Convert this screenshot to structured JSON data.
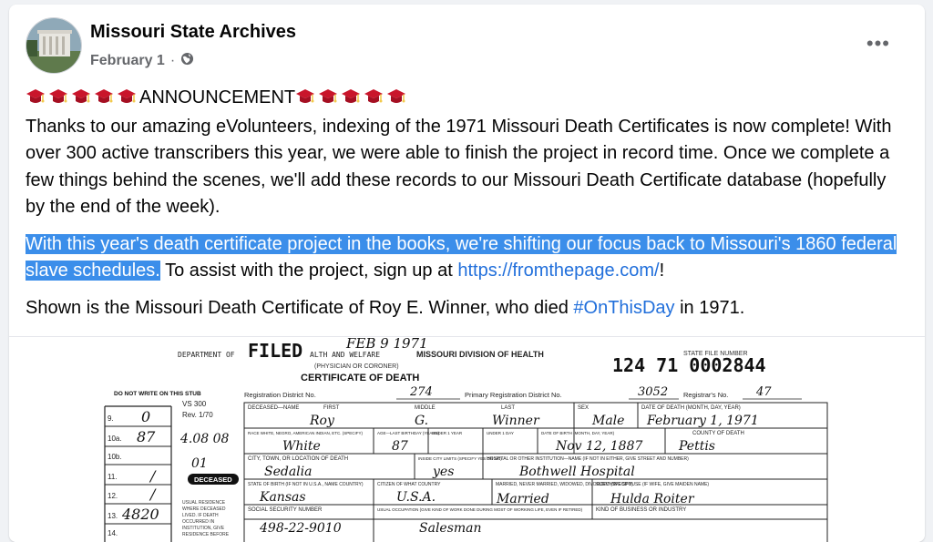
{
  "post": {
    "page_name": "Missouri State Archives",
    "date": "February 1",
    "separator": "·",
    "announcement_caps_count": 5,
    "announcement_word": "ANNOUNCEMENT",
    "paragraph1": "Thanks to our amazing eVolunteers, indexing of the 1971 Missouri Death Certificates is now complete! With over 300 active transcribers this year, we were able to finish the project in record time. Once we complete a few things behind the scenes, we'll add these records to our Missouri Death Certificate database (hopefully by the end of the week).",
    "paragraph2_highlighted": "With this year's death certificate project in the books, we're shifting our focus back to Missouri's 1860 federal slave schedules.",
    "paragraph2_rest": " To assist with the project, sign up at ",
    "paragraph2_link": "https://fromthepage.com/",
    "paragraph2_end": "!",
    "paragraph3_start": "Shown is the Missouri Death Certificate of Roy E. Winner, who died ",
    "paragraph3_hashtag": "#OnThisDay",
    "paragraph3_end": " in 1971."
  },
  "certificate": {
    "header_left": "DEPARTMENT OF",
    "filed_stamp": "FILED",
    "header_mid": "ALTH AND WELFARE",
    "header_right": "MISSOURI DIVISION OF HEALTH",
    "date_stamp": "FEB 9   1971",
    "physician": "(PHYSICIAN OR CORONER)",
    "title": "CERTIFICATE OF DEATH",
    "file_number_label": "STATE FILE NUMBER",
    "file_number": "124  71  0002844",
    "reg_district_label": "Registration District No.",
    "reg_district": "274",
    "primary_label": "Primary Registration District No.",
    "primary": "3052",
    "registrar_label": "Registrar's No.",
    "registrar": "47",
    "stub_label": "DO NOT WRITE ON THIS STUB",
    "vs": "VS 300",
    "rev": "Rev. 1/70",
    "deceased_badge": "DECEASED",
    "first_name": "Roy",
    "middle_name": "G.",
    "last_name": "Winner",
    "sex": "Male",
    "date_of_death": "February 1, 1971",
    "race": "White",
    "age": "87",
    "dob": "Nov 12, 1887",
    "county": "Pettis",
    "city": "Sedalia",
    "inside_city": "yes",
    "hospital": "Bothwell Hospital",
    "state_birth": "Kansas",
    "citizen": "U.S.A.",
    "marital": "Married",
    "spouse": "Hulda Roiter",
    "ssn": "498-22-9010",
    "occupation": "Salesman",
    "stub_values": [
      "0",
      "87",
      "",
      "",
      "",
      "4820"
    ],
    "stub_side": [
      "4.08 08",
      "01"
    ],
    "labels": {
      "deceased_name": "DECEASED—NAME",
      "first": "FIRST",
      "middle": "MIDDLE",
      "last": "LAST",
      "sex": "SEX",
      "date_of_death": "DATE OF DEATH (MONTH, DAY, YEAR)",
      "race": "RACE WHITE, NEGRO, AMERICAN INDIAN, ETC. (SPECIFY)",
      "age": "AGE—LAST BIRTHDAY (YEARS)",
      "under_1_year": "UNDER 1 YEAR",
      "under_1_day": "UNDER 1 DAY",
      "date_of_birth": "DATE OF BIRTH (MONTH, DAY, YEAR)",
      "county_of_death": "COUNTY OF DEATH",
      "city": "CITY, TOWN, OR LOCATION OF DEATH",
      "inside_city": "INSIDE CITY LIMITS (SPECIFY YES OR NO)",
      "hospital": "HOSPITAL OR OTHER INSTITUTION—NAME (IF NOT IN EITHER, GIVE STREET AND NUMBER)",
      "state_birth": "STATE OF BIRTH (IF NOT IN U.S.A., NAME COUNTRY)",
      "citizen": "CITIZEN OF WHAT COUNTRY",
      "marital": "MARRIED, NEVER MARRIED, WIDOWED, DIVORCED (SPECIFY)",
      "spouse": "SURVIVING SPOUSE (IF WIFE, GIVE MAIDEN NAME)",
      "ssn": "SOCIAL SECURITY NUMBER",
      "occupation": "USUAL OCCUPATION (GIVE KIND OF WORK DONE DURING MOST OF WORKING LIFE, EVEN IF RETIRED)",
      "business": "KIND OF BUSINESS OR INDUSTRY",
      "usual_residence": "USUAL RESIDENCE WHERE DECEASED LIVED. IF DEATH OCCURRED IN INSTITUTION, GIVE RESIDENCE BEFORE"
    }
  }
}
